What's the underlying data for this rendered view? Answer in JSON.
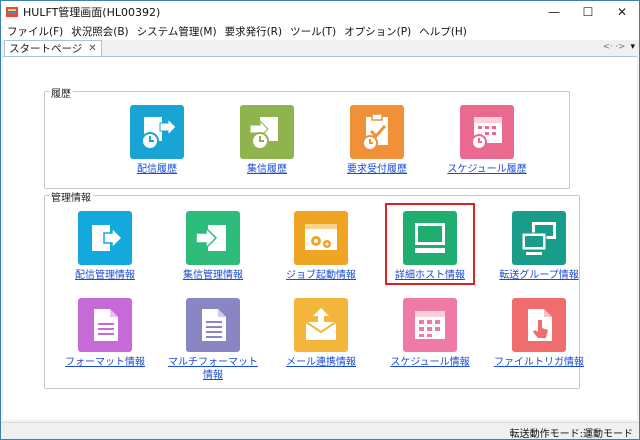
{
  "window": {
    "title": "HULFT管理画面(HL00392)",
    "minimize": "—",
    "maximize": "☐",
    "close": "✕"
  },
  "menu": [
    {
      "label": "ファイル(F)"
    },
    {
      "label": "状況照会(B)"
    },
    {
      "label": "システム管理(M)"
    },
    {
      "label": "要求発行(R)"
    },
    {
      "label": "ツール(T)"
    },
    {
      "label": "オプション(P)"
    },
    {
      "label": "ヘルプ(H)"
    }
  ],
  "tab": {
    "label": "スタートページ",
    "close": "✕",
    "nav_left": "<·",
    "nav_right": "·>",
    "nav_menu": "▾"
  },
  "history": {
    "label": "履歴",
    "items": [
      {
        "label": "配信履歴",
        "icon": "send-history-icon",
        "color": "#1aa4d4"
      },
      {
        "label": "集信履歴",
        "icon": "receive-history-icon",
        "color": "#8fb44e"
      },
      {
        "label": "要求受付履歴",
        "icon": "request-history-icon",
        "color": "#f0913a"
      },
      {
        "label": "スケジュール履歴",
        "icon": "schedule-history-icon",
        "color": "#ea6a8f"
      }
    ]
  },
  "management": {
    "label": "管理情報",
    "items": [
      {
        "label": "配信管理情報",
        "icon": "send-management-icon",
        "color": "#13a9dd"
      },
      {
        "label": "集信管理情報",
        "icon": "receive-management-icon",
        "color": "#2dbc7a"
      },
      {
        "label": "ジョブ起動情報",
        "icon": "job-start-icon",
        "color": "#f0a424"
      },
      {
        "label": "詳細ホスト情報",
        "icon": "host-detail-icon",
        "color": "#1fae6f"
      },
      {
        "label": "転送グループ情報",
        "icon": "transfer-group-icon",
        "color": "#1a9c8a"
      },
      {
        "label": "フォーマット情報",
        "icon": "format-icon",
        "color": "#c56ad6"
      },
      {
        "label": "マルチフォーマット",
        "label2": "情報",
        "icon": "multi-format-icon",
        "color": "#8a86c4"
      },
      {
        "label": "メール連携情報",
        "icon": "mail-icon",
        "color": "#f3b63a"
      },
      {
        "label": "スケジュール情報",
        "icon": "schedule-icon",
        "color": "#f07aa6"
      },
      {
        "label": "ファイルトリガ情報",
        "icon": "file-trigger-icon",
        "color": "#ef6d6d"
      }
    ]
  },
  "status": {
    "text": "転送動作モード:運動モード"
  }
}
